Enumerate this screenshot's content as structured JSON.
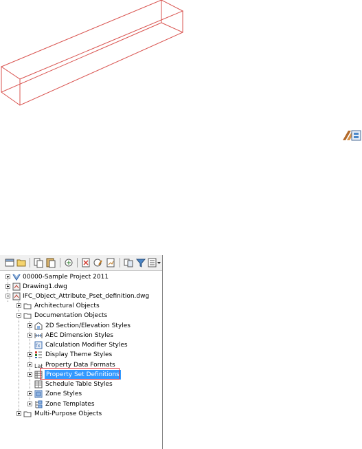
{
  "tree": {
    "items": [
      {
        "label": "00000-Sample Project 2011",
        "icon": "project-icon"
      },
      {
        "label": "Drawing1.dwg",
        "icon": "drawing-icon"
      },
      {
        "label": "IFC_Object_Attribute_Pset_definition.dwg",
        "icon": "drawing-icon"
      },
      {
        "label": "Architectural Objects",
        "icon": "folder-icon"
      },
      {
        "label": "Documentation Objects",
        "icon": "folder-icon"
      },
      {
        "label": "2D Section/Elevation Styles",
        "icon": "section-elevation-icon"
      },
      {
        "label": "AEC Dimension Styles",
        "icon": "dimension-style-icon"
      },
      {
        "label": "Calculation Modifier Styles",
        "icon": "calculation-modifier-icon"
      },
      {
        "label": "Display Theme Styles",
        "icon": "display-theme-icon"
      },
      {
        "label": "Property Data Formats",
        "icon": "property-data-format-icon"
      },
      {
        "label": "Property Set Definitions",
        "icon": "property-set-icon"
      },
      {
        "label": "Schedule Table Styles",
        "icon": "schedule-table-icon"
      },
      {
        "label": "Zone Styles",
        "icon": "zone-style-icon"
      },
      {
        "label": "Zone Templates",
        "icon": "zone-template-icon"
      },
      {
        "label": "Multi-Purpose Objects",
        "icon": "folder-icon"
      }
    ],
    "selected": "Property Set Definitions"
  },
  "toolbar": {
    "icons": [
      "new-icon",
      "open-icon",
      "copy-icon",
      "paste-icon",
      "purge-icon",
      "delete-icon",
      "edit-icon",
      "import-export-icon",
      "synchronize-icon",
      "filter-icon",
      "view-dropdown-icon"
    ]
  },
  "colors": {
    "wireframe": "#d9534f",
    "selection": "#3399ff",
    "highlight_box": "#e0303a"
  }
}
